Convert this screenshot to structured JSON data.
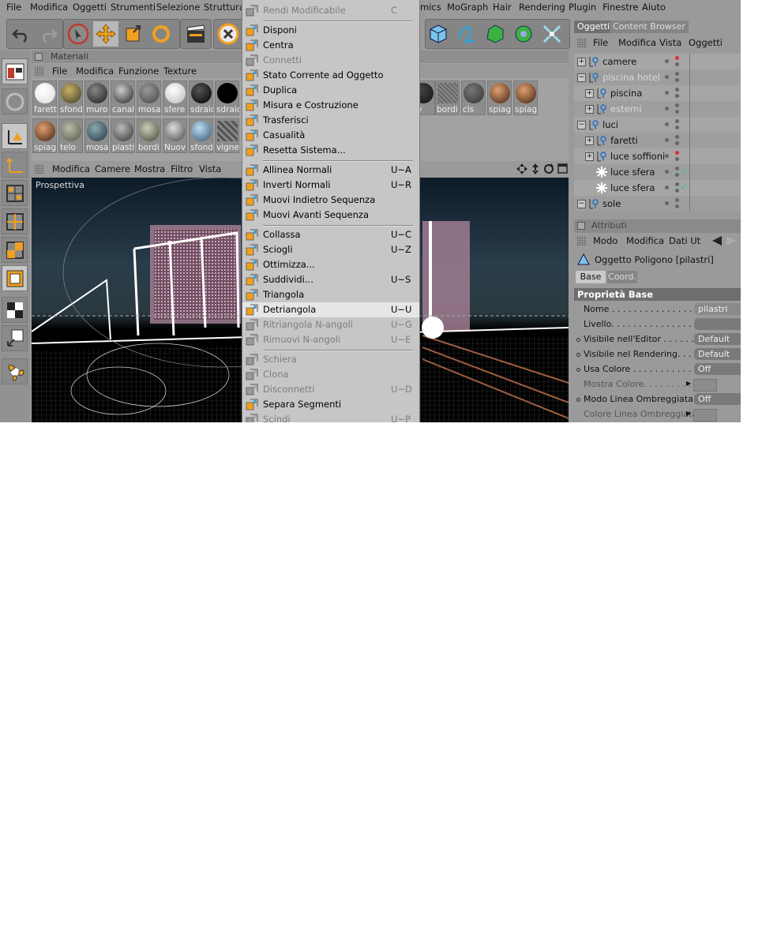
{
  "menubar": {
    "items": [
      "File",
      "Modifica",
      "Oggetti",
      "Strumenti",
      "Selezione",
      "Struttura"
    ],
    "items_right": [
      "mics",
      "MoGraph",
      "Hair",
      "Rendering",
      "Plugin",
      "Finestre",
      "Aiuto"
    ]
  },
  "materials": {
    "title": "Materiali",
    "menu": [
      "File",
      "Modifica",
      "Funzione",
      "Texture"
    ],
    "row1": [
      "faretti",
      "sfond",
      "muro",
      "canal",
      "mosa",
      "sfere",
      "sdraic",
      "sdraic"
    ],
    "row1_right": [
      "ov",
      "bordi",
      "cls",
      "spiag",
      "spiag"
    ],
    "row2": [
      "spiag",
      "telo",
      "mosa",
      "plastic",
      "bordi",
      "Nuov",
      "sfond",
      "vigne"
    ]
  },
  "viewport": {
    "menu": [
      "Modifica",
      "Camere",
      "Mostra",
      "Filtro",
      "Vista"
    ],
    "label": "Prospettiva"
  },
  "popup": {
    "items": [
      {
        "label": "Rendi Modificabile",
        "shortcut": "C",
        "disabled": true
      },
      {
        "sep": true
      },
      {
        "label": "Disponi",
        "shortcut": "",
        "disabled": false
      },
      {
        "label": "Centra",
        "shortcut": "",
        "disabled": false
      },
      {
        "label": "Connetti",
        "shortcut": "",
        "disabled": true
      },
      {
        "label": "Stato Corrente ad Oggetto",
        "shortcut": "",
        "disabled": false
      },
      {
        "label": "Duplica",
        "shortcut": "",
        "disabled": false
      },
      {
        "label": "Misura e Costruzione",
        "shortcut": "",
        "disabled": false
      },
      {
        "label": "Trasferisci",
        "shortcut": "",
        "disabled": false
      },
      {
        "label": "Casualità",
        "shortcut": "",
        "disabled": false
      },
      {
        "label": "Resetta Sistema...",
        "shortcut": "",
        "disabled": false
      },
      {
        "sep": true
      },
      {
        "label": "Allinea Normali",
        "shortcut": "U~A",
        "disabled": false
      },
      {
        "label": "Inverti Normali",
        "shortcut": "U~R",
        "disabled": false
      },
      {
        "label": "Muovi Indietro Sequenza",
        "shortcut": "",
        "disabled": false
      },
      {
        "label": "Muovi Avanti Sequenza",
        "shortcut": "",
        "disabled": false
      },
      {
        "sep": true
      },
      {
        "label": "Collassa",
        "shortcut": "U~C",
        "disabled": false
      },
      {
        "label": "Sciogli",
        "shortcut": "U~Z",
        "disabled": false
      },
      {
        "label": "Ottimizza...",
        "shortcut": "",
        "disabled": false
      },
      {
        "label": "Suddividi...",
        "shortcut": "U~S",
        "disabled": false
      },
      {
        "label": "Triangola",
        "shortcut": "",
        "disabled": false
      },
      {
        "label": "Detriangola",
        "shortcut": "U~U",
        "disabled": false,
        "highlight": true
      },
      {
        "label": "Ritriangola N-angoli",
        "shortcut": "U~G",
        "disabled": true
      },
      {
        "label": "Rimuovi N-angoli",
        "shortcut": "U~E",
        "disabled": true
      },
      {
        "sep": true
      },
      {
        "label": "Schiera",
        "shortcut": "",
        "disabled": true
      },
      {
        "label": "Clona",
        "shortcut": "",
        "disabled": true
      },
      {
        "label": "Disconnetti",
        "shortcut": "U~D",
        "disabled": true
      },
      {
        "label": "Separa Segmenti",
        "shortcut": "",
        "disabled": false
      },
      {
        "label": "Scindi",
        "shortcut": "U~P",
        "disabled": true
      }
    ]
  },
  "objects": {
    "tabs": [
      "Oggetti",
      "Content Browser"
    ],
    "menu": [
      "File",
      "Modifica",
      "Vista",
      "Oggetti"
    ],
    "rows": [
      {
        "name": "camere",
        "level": 0,
        "exp": "+",
        "muted": false,
        "red": true
      },
      {
        "name": "piscina hotel",
        "level": 0,
        "exp": "-",
        "muted": true,
        "red": false
      },
      {
        "name": "piscina",
        "level": 1,
        "exp": "+",
        "muted": false,
        "red": false
      },
      {
        "name": "esterni",
        "level": 1,
        "exp": "+",
        "muted": true,
        "red": false
      },
      {
        "name": "luci",
        "level": 0,
        "exp": "-",
        "muted": false,
        "red": false
      },
      {
        "name": "faretti",
        "level": 1,
        "exp": "+",
        "muted": false,
        "red": false
      },
      {
        "name": "luce soffioni",
        "level": 1,
        "exp": "+",
        "muted": false,
        "red": true
      },
      {
        "name": "luce sfera",
        "level": 1,
        "exp": "",
        "muted": false,
        "red": false,
        "check": true
      },
      {
        "name": "luce sfera",
        "level": 1,
        "exp": "",
        "muted": false,
        "red": false,
        "check": true
      },
      {
        "name": "sole",
        "level": 0,
        "exp": "-",
        "muted": false,
        "red": false
      }
    ]
  },
  "attributes": {
    "title": "Attributi",
    "menu": [
      "Modo",
      "Modifica",
      "Dati Ut"
    ],
    "object_label": "Oggetto Poligono [pilastri]",
    "tabs": [
      "Base",
      "Coord."
    ],
    "section": "Proprietà Base",
    "rows": [
      {
        "label": "Nome . . . . . . . . . . . . . . . . . . .",
        "value": "pilastri",
        "radio": false,
        "dim": false
      },
      {
        "label": "Livello. . . . . . . . . . . . . . . . . . .",
        "value": "",
        "radio": false,
        "dim": false
      },
      {
        "label": "Visibile nell'Editor . . . . . . . . . .",
        "value": "Default",
        "radio": true,
        "dim": false
      },
      {
        "label": "Visibile nel Rendering. . . . . . .",
        "value": "Default",
        "radio": true,
        "dim": false
      },
      {
        "label": "Usa Colore . . . . . . . . . . . . . . .",
        "value": "Off",
        "radio": true,
        "dim": false
      },
      {
        "label": "Mostra Colore. . . . . . . . . . .",
        "value": "",
        "radio": false,
        "dim": true,
        "swatch": true
      },
      {
        "label": "Modo Linea Ombreggiata. . . .",
        "value": "Off",
        "radio": true,
        "dim": false
      },
      {
        "label": "Colore Linea Ombreggiata",
        "value": "",
        "radio": false,
        "dim": true,
        "swatch": true
      }
    ]
  },
  "colors": {
    "accent": "#f0a020",
    "highlight": "#e6e6e6",
    "panel": "#9a9a9a"
  }
}
